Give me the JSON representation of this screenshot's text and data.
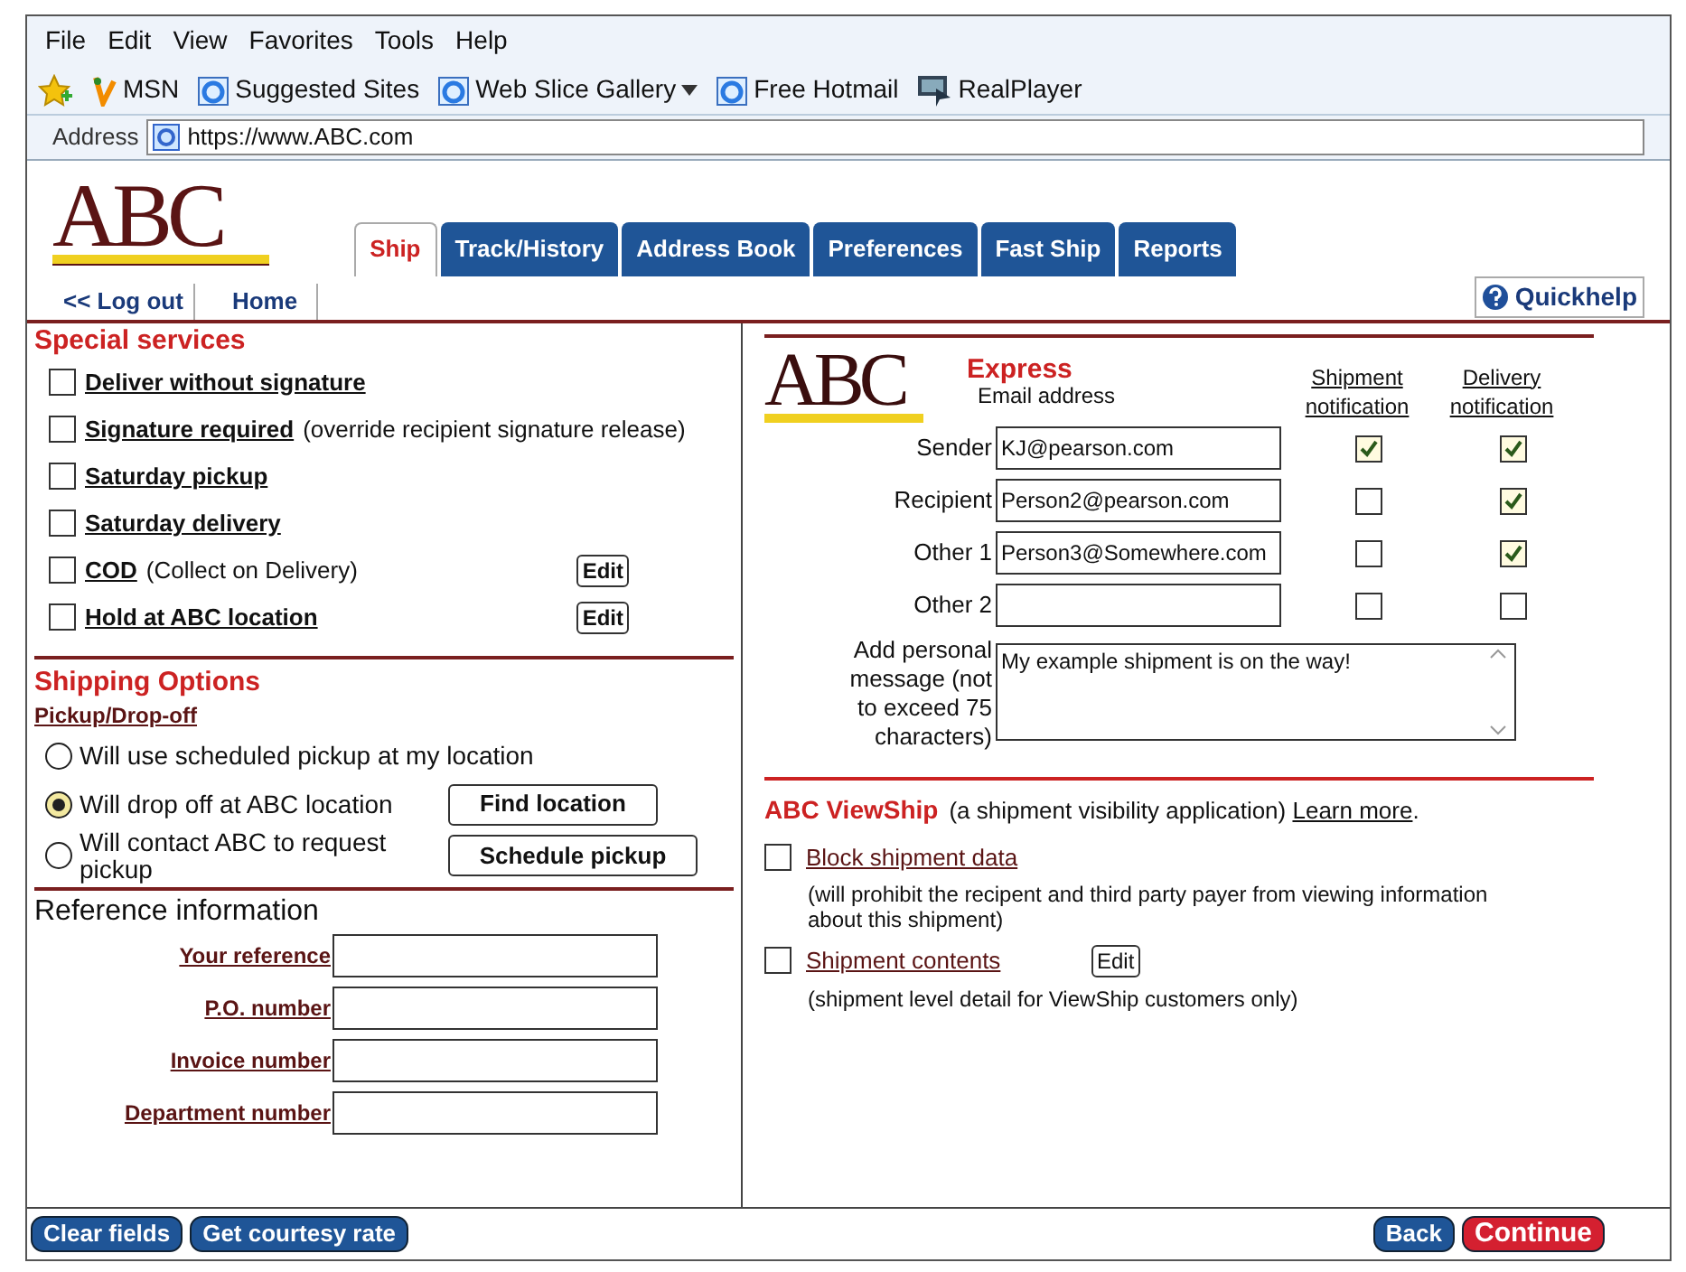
{
  "menu_bar": [
    "File",
    "Edit",
    "View",
    "Favorites",
    "Tools",
    "Help"
  ],
  "favorites_bar": [
    {
      "label": "MSN",
      "kind": "msn",
      "dropdown": false
    },
    {
      "label": "Suggested Sites",
      "kind": "ie",
      "dropdown": false
    },
    {
      "label": "Web Slice Gallery",
      "kind": "ie",
      "dropdown": true
    },
    {
      "label": "Free Hotmail",
      "kind": "ie",
      "dropdown": false
    },
    {
      "label": "RealPlayer",
      "kind": "player",
      "dropdown": false
    }
  ],
  "address_bar": {
    "label": "Address",
    "value": "https://www.ABC.com"
  },
  "logo": "ABC",
  "tabs": [
    {
      "label": "Ship",
      "selected": true
    },
    {
      "label": "Track/History",
      "selected": false
    },
    {
      "label": "Address Book",
      "selected": false
    },
    {
      "label": "Preferences",
      "selected": false
    },
    {
      "label": "Fast Ship",
      "selected": false
    },
    {
      "label": "Reports",
      "selected": false
    }
  ],
  "nav_links": [
    "<< Log out",
    "Home"
  ],
  "quickhelp": "Quickhelp",
  "special_services": {
    "title": "Special services",
    "items": [
      {
        "label": "Deliver without signature",
        "checked": false
      },
      {
        "label": "Signature required",
        "note": "(override recipient signature release)",
        "checked": false
      },
      {
        "label": "Saturday pickup",
        "checked": false
      },
      {
        "label": "Saturday delivery",
        "checked": false
      },
      {
        "label": "COD",
        "note": "(Collect on Delivery)",
        "checked": false,
        "edit": "Edit"
      },
      {
        "label": "Hold at ABC location",
        "checked": false,
        "edit": "Edit"
      }
    ]
  },
  "shipping_options": {
    "title": "Shipping Options",
    "subtitle": "Pickup/Drop-off",
    "options": [
      {
        "label": "Will use scheduled pickup at my location",
        "selected": false
      },
      {
        "label": "Will drop off at ABC location",
        "selected": true,
        "button": "Find location"
      },
      {
        "label": "Will contact ABC to request pickup",
        "selected": false,
        "button": "Schedule pickup"
      }
    ]
  },
  "reference_information": {
    "title": "Reference information",
    "fields": [
      "Your reference",
      "P.O. number",
      "Invoice number",
      "Department number"
    ]
  },
  "express": {
    "logo": "ABC",
    "title": "Express",
    "columns": [
      "Email address",
      "Shipment notification",
      "Delivery notification"
    ],
    "rows": [
      {
        "label": "Sender",
        "value": "KJ@pearson.com",
        "shipment_notification": true,
        "delivery_notification": true
      },
      {
        "label": "Recipient",
        "value": "Person2@pearson.com",
        "shipment_notification": false,
        "delivery_notification": true
      },
      {
        "label": "Other 1",
        "value": "Person3@Somewhere.com",
        "shipment_notification": false,
        "delivery_notification": true
      },
      {
        "label": "Other 2",
        "shipment_notification": false,
        "delivery_notification": false
      }
    ],
    "message": {
      "label": "Add personal message (not to exceed 75 characters)",
      "value": "My example shipment is on the way!"
    }
  },
  "viewship": {
    "title": "ABC ViewShip",
    "description": "(a shipment visibility application)",
    "link": "Learn more",
    "trailing": ".",
    "items": [
      {
        "label": "Block shipment data",
        "checked": false,
        "note": "(will prohibit the recipent and third party payer from viewing information about this shipment)"
      },
      {
        "label": "Shipment contents",
        "checked": false,
        "edit": "Edit",
        "note": "(shipment level detail for ViewShip customers only)"
      }
    ]
  },
  "footer_left": [
    {
      "label": "Clear fields",
      "kind": "blue"
    },
    {
      "label": "Get courtesy rate",
      "kind": "blue"
    }
  ],
  "footer_right": [
    {
      "label": "Back",
      "kind": "blue"
    },
    {
      "label": "Continue",
      "kind": "red"
    }
  ]
}
